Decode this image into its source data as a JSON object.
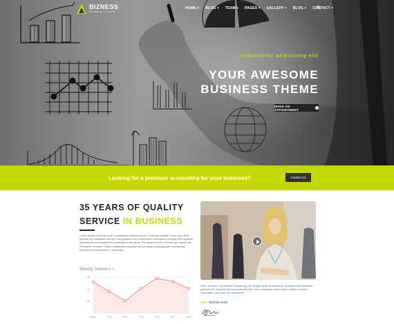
{
  "brand": {
    "name": "BIZNESS",
    "tagline": "Business and Corporate",
    "accent_color": "#c5d800"
  },
  "nav": {
    "items": [
      {
        "label": "HOME",
        "icon": "caret-down-icon"
      },
      {
        "label": "BLOG",
        "icon": "caret-down-icon"
      },
      {
        "label": "TEAM",
        "icon": "caret-down-icon"
      },
      {
        "label": "PAGES",
        "icon": "caret-down-icon"
      },
      {
        "label": "GALLERY",
        "icon": "caret-down-icon"
      },
      {
        "label": "BLOG",
        "icon": "caret-down-icon"
      },
      {
        "label": "CONTACT",
        "icon": "caret-down-icon"
      }
    ],
    "search_icon": "search-icon"
  },
  "hero": {
    "eyebrow": "consectetur adipisicing elit",
    "title_line1": "YOUR AWESOME",
    "title_line2": "BUSINESS THEME",
    "button_label": "MAKE AN APPOINTMENT"
  },
  "cta": {
    "text": "Looking for a premium accounting for your business?",
    "button_label": "Contact Us"
  },
  "about": {
    "title_line1": "35 YEARS OF QUALITY",
    "title_line2_dark": "SERVICE ",
    "title_line2_accent": "IN BUSINESS",
    "intro": "Lorem ipsum dolor sit amet, consectetur adipisicing elit. Odio adit deleniti, iusto, quo unde repellat qui cupiditate ratione nam quidem eum, laboriosam voluptatum suscipit velit sapiente dignissimos exercitationem molestias omnis quas. Est sapiente enim eveniet qui, quam hic! Provident, dolorem. Totam voluptatum assumenda eos alias consequuntur recusandae provident exercitationem, obcaecati."
  },
  "stats": {
    "title": "Weekly Statistics",
    "icon": "refresh-icon"
  },
  "chart_data": {
    "type": "line",
    "categories": [
      "MON",
      "TUE",
      "WED",
      "THU",
      "FRI",
      "SAT",
      "SUN"
    ],
    "values": [
      52,
      36,
      20,
      41,
      58,
      53,
      41
    ],
    "ylim": [
      0,
      60
    ],
    "yticks": [
      20,
      40,
      60
    ],
    "line_color": "#f08080",
    "fill_color": "#fde8e8",
    "grid": true
  },
  "video": {
    "play_icon": "play-icon",
    "caption": "Dolor sit amet, consectetur adipisicing elit. Eaque quaerat debitis at, voluptas nulla distinctio placeat velit assumenda veniendis dolorem eum numquam totam atque pariatur adipisci voluptates, quo iusto ea. Numquam.",
    "role": "CEO",
    "name": "Martina Joele"
  }
}
